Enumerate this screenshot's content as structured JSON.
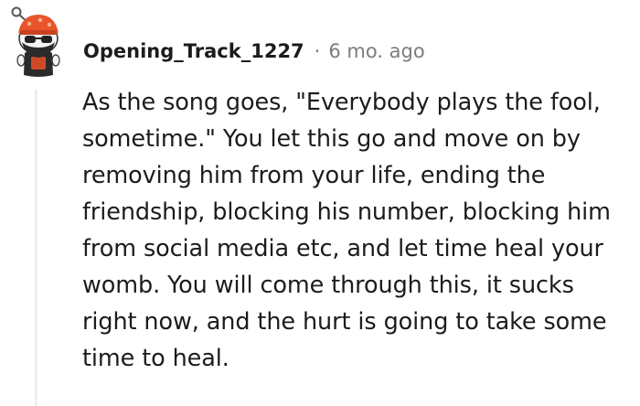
{
  "comment": {
    "author": "Opening_Track_1227",
    "separator": "·",
    "age": "6 mo. ago",
    "avatar_icon": "snoo-avatar-icon",
    "body": "As the song goes, \"Everybody plays the fool, sometime.\" You let this go and move on by removing him from your life, ending the friendship, blocking his number, blocking him from social media etc, and let time heal your womb. You will come through this, it sucks right now, and the hurt is going to take some time to heal."
  },
  "colors": {
    "text": "#1c1c1c",
    "meta": "#7c7c7c",
    "thread_line": "#edeff1",
    "avatar_hat": "#e8552a",
    "avatar_beard": "#2b2b2b"
  }
}
